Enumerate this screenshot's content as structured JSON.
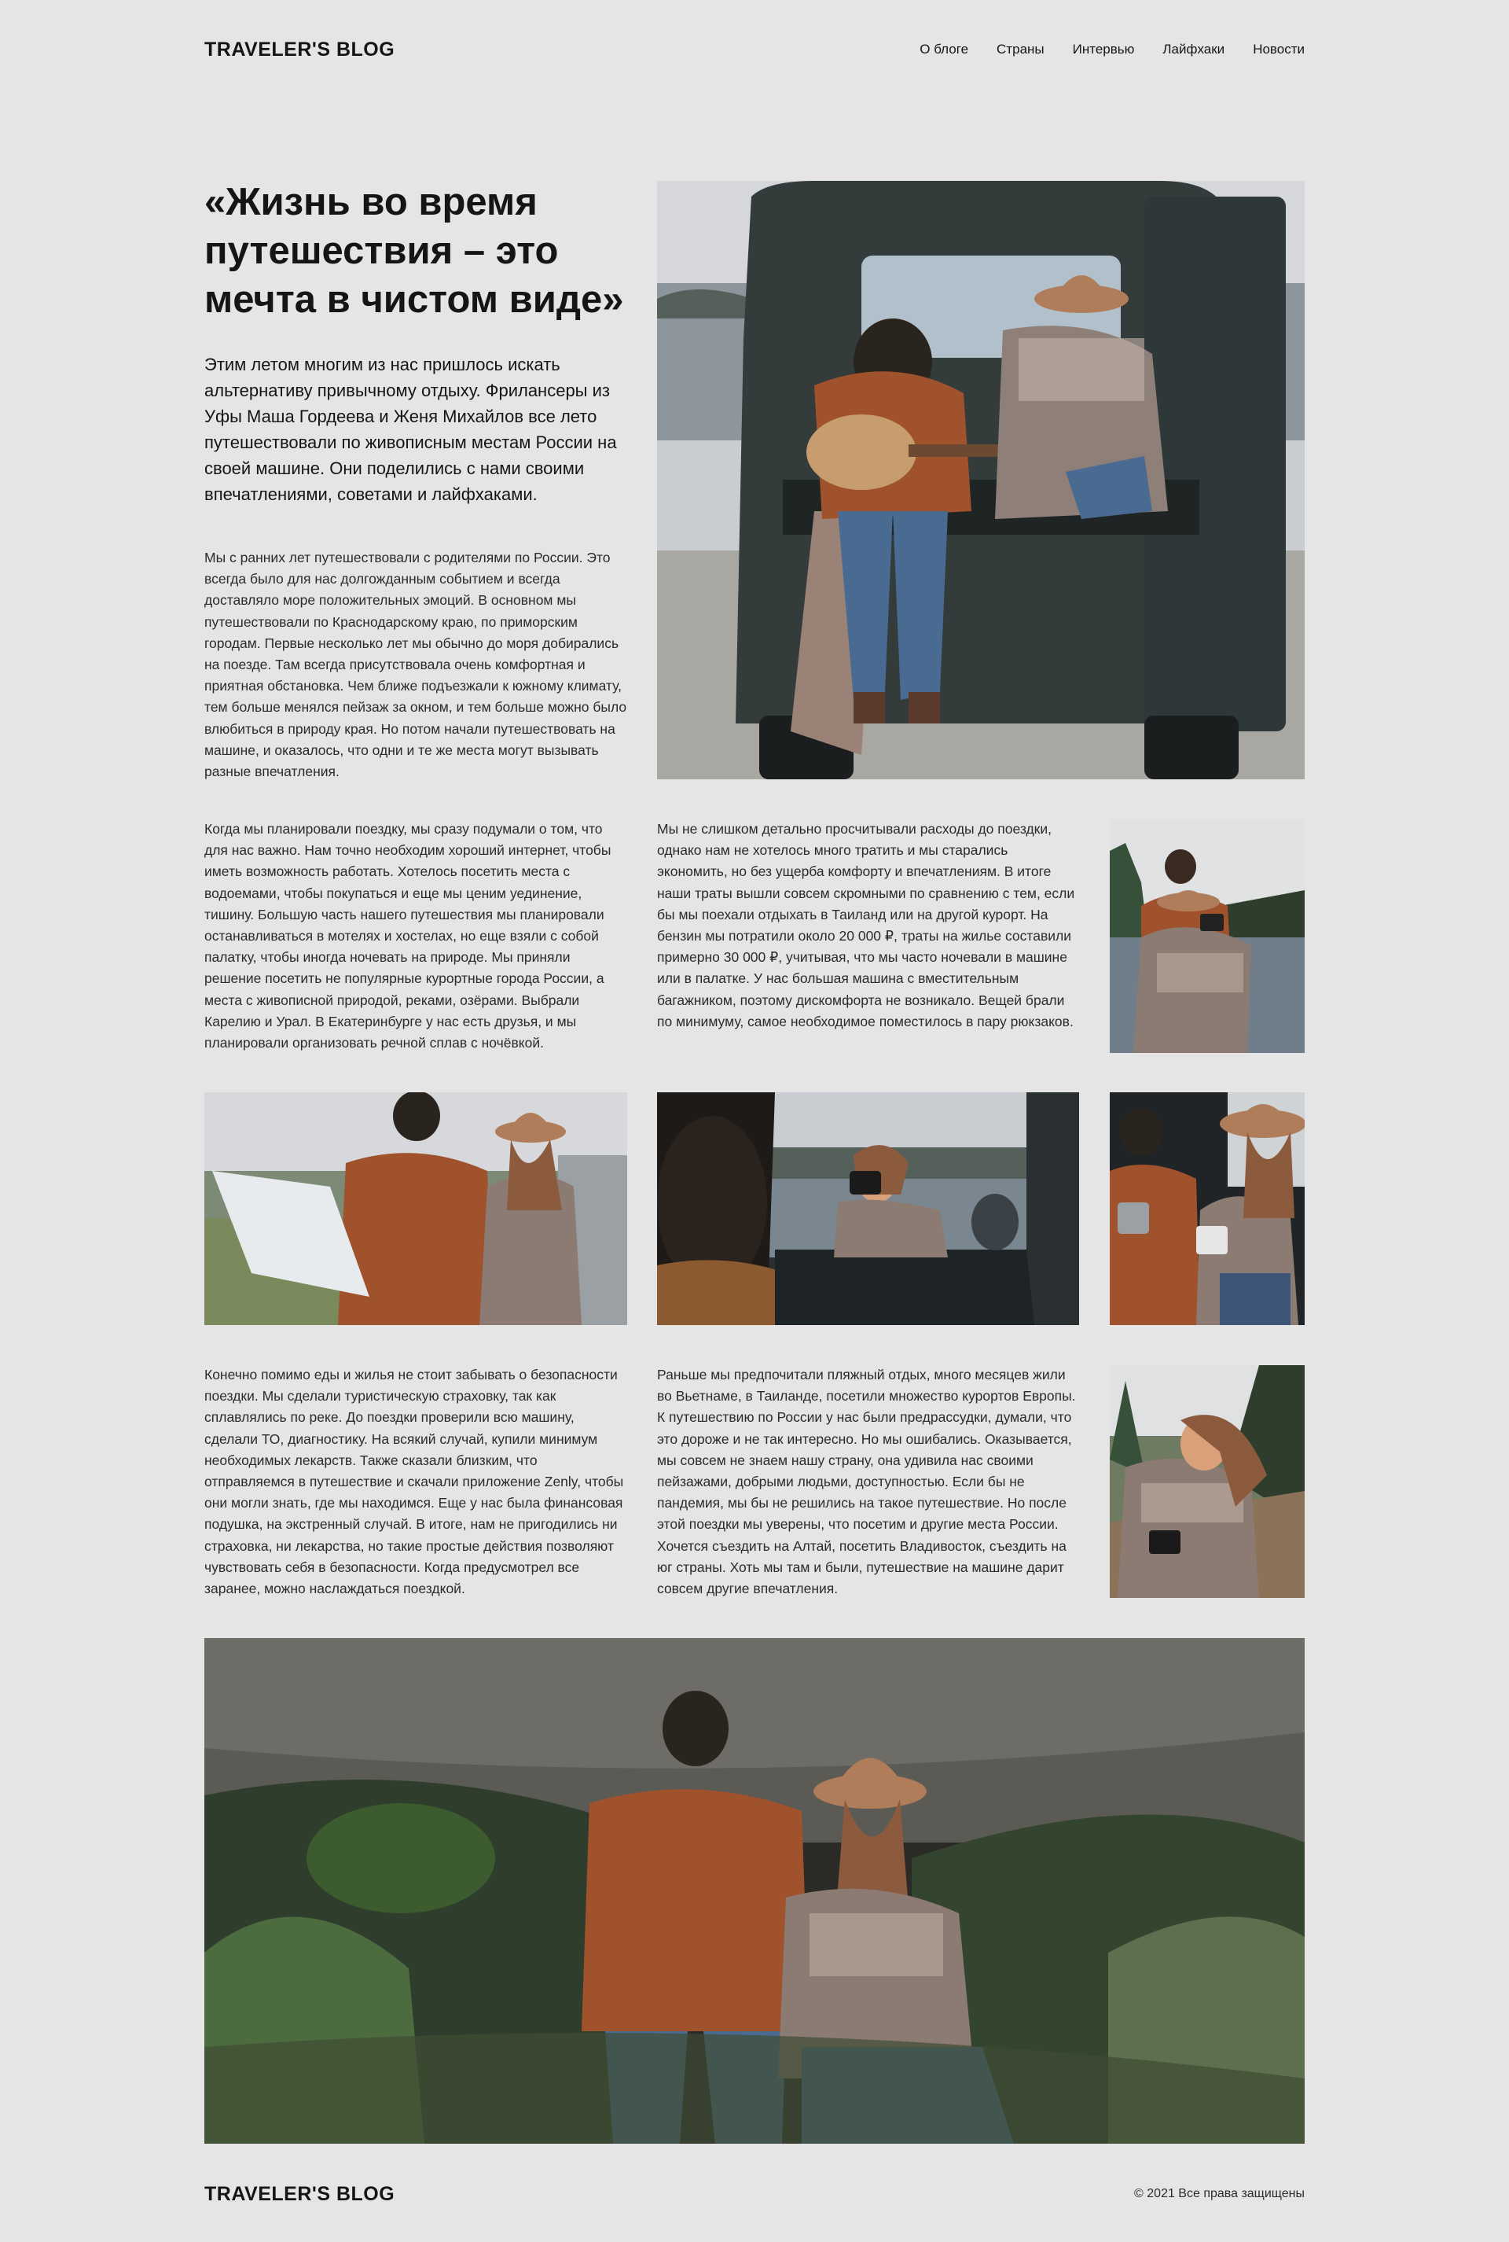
{
  "header": {
    "logo": "TRAVELER'S BLOG",
    "nav": [
      "О блоге",
      "Страны",
      "Интервью",
      "Лайфхаки",
      "Новости"
    ]
  },
  "hero": {
    "title": "«Жизнь во время путешествия – это мечта в чистом виде»",
    "lead": "Этим летом многим из нас пришлось искать альтернативу привычному отдыху. Фрилансеры из Уфы Маша Гордеева и Женя Михайлов все лето путешествовали по живописным местам России на своей машине. Они поделились с нами своими впечатлениями, советами и лайфхаками."
  },
  "paragraphs": {
    "p1": "Мы с ранних лет путешествовали с родителями по России. Это всегда было для нас долгожданным событием и всегда доставляло море положительных эмоций. В основном мы путешествовали по Краснодарскому краю, по приморским городам. Первые несколько лет мы обычно до моря добирались на поезде. Там всегда присутствовала очень комфортная и приятная обстановка. Чем ближе подъезжали к южному климату, тем больше менялся пейзаж за окном, и тем больше можно было влюбиться в природу края. Но потом начали путешествовать на машине, и оказалось, что одни и те же места могут вызывать разные впечатления.",
    "p2": "Когда мы планировали поездку, мы сразу подумали о том, что для нас важно. Нам точно необходим хороший интернет, чтобы иметь возможность работать. Хотелось посетить места с водоемами, чтобы покупаться и еще мы ценим уединение, тишину. Большую часть нашего путешествия мы планировали останавливаться в мотелях и хостелах, но еще взяли с собой палатку, чтобы иногда ночевать на природе. Мы приняли решение посетить не популярные курортные города России, а места с живописной природой, реками, озёрами. Выбрали Карелию и Урал. В Екатеринбурге у нас есть друзья, и мы планировали организовать речной сплав с ночёвкой.",
    "p3": "Мы не слишком детально просчитывали расходы до поездки, однако нам не хотелось много тратить и мы старались экономить, но без ущерба комфорту и впечатлениям. В итоге наши траты вышли совсем скромными по сравнению с тем, если бы мы поехали отдыхать в Таиланд или на другой курорт. На бензин мы потратили около 20 000 ₽, траты на жилье составили примерно 30 000 ₽, учитывая, что мы часто ночевали в машине или в палатке. У нас большая машина с вместительным багажником, поэтому дискомфорта не возникало. Вещей брали по минимуму, самое необходимое поместилось в пару рюкзаков.",
    "p4": "Конечно помимо еды и жилья не стоит забывать о безопасности поездки. Мы сделали туристическую страховку, так как сплавлялись по реке. До поездки проверили всю машину, сделали ТО, диагностику. На всякий случай, купили минимум необходимых лекарств. Также сказали близким, что отправляемся в путешествие и скачали приложение Zenly, чтобы они могли знать, где мы находимся. Еще у нас была финансовая подушка, на экстренный случай. В итоге, нам не пригодились ни страховка, ни лекарства, но такие простые действия позволяют чувствовать себя в безопасности. Когда предусмотрел все заранее, можно наслаждаться поездкой.",
    "p5": "Раньше мы предпочитали пляжный отдых, много месяцев жили во Вьетнаме, в Таиланде, посетили множество курортов Европы. К путешествию по России у нас были предрассудки, думали, что это дороже и не так интересно. Но мы ошибались. Оказывается, мы совсем не знаем нашу страну, она удивила нас своими пейзажами, добрыми людьми, доступностью. Если бы не пандемия, мы бы не решились на такое путешествие. Но после этой поездки мы уверены, что посетим и другие места России. Хочется съездить на Алтай, посетить Владивосток, съездить на юг страны. Хоть мы там и были, путешествие на машине дарит совсем другие впечатления."
  },
  "footer": {
    "logo": "TRAVELER'S BLOG",
    "copyright": "© 2021 Все права защищены"
  },
  "colors": {
    "background": "#e5e5e5",
    "text": "#151515",
    "sweater": "#a0522d",
    "jeans": "#4a6b91",
    "hat": "#b07d5a",
    "forest": "#2f3e2c"
  }
}
